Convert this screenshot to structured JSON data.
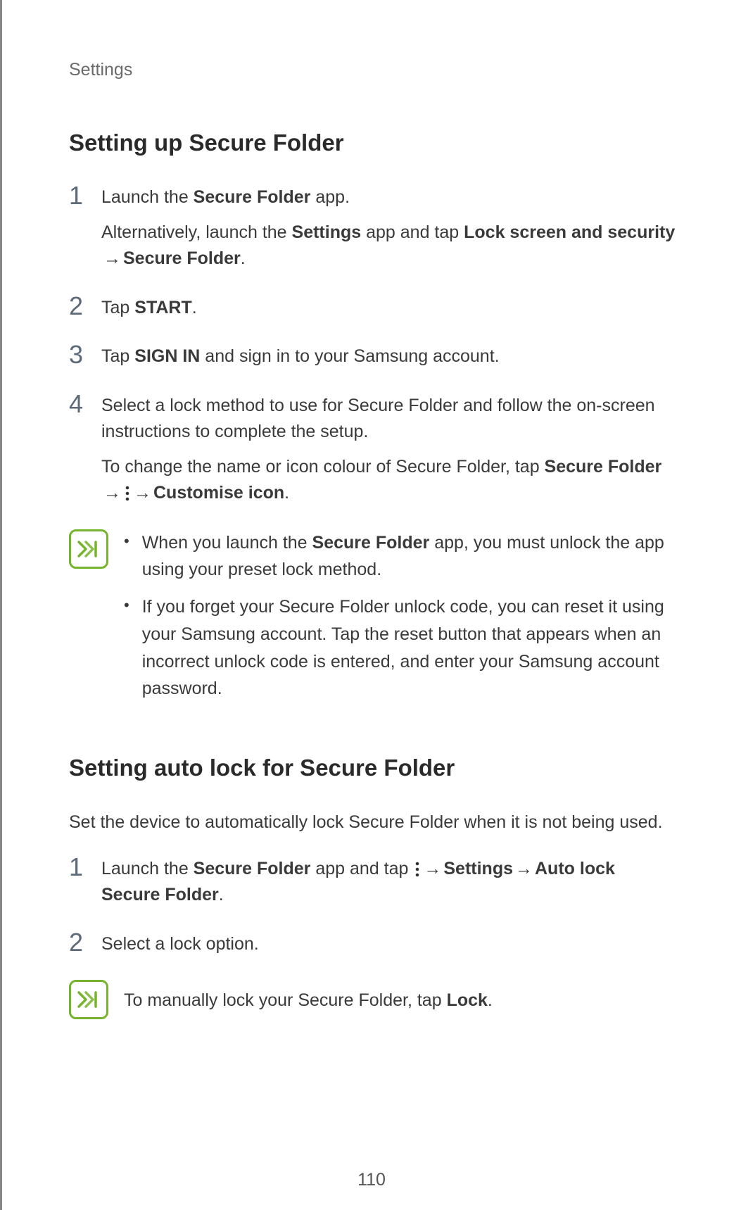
{
  "header": "Settings",
  "section1": {
    "heading": "Setting up Secure Folder",
    "steps": {
      "1": {
        "num": "1",
        "line1_a": "Launch the ",
        "line1_b": "Secure Folder",
        "line1_c": " app.",
        "line2_a": "Alternatively, launch the ",
        "line2_b": "Settings",
        "line2_c": " app and tap ",
        "line2_d": "Lock screen and security",
        "line2_e": "Secure Folder",
        "line2_f": "."
      },
      "2": {
        "num": "2",
        "line_a": "Tap ",
        "line_b": "START",
        "line_c": "."
      },
      "3": {
        "num": "3",
        "line_a": "Tap ",
        "line_b": "SIGN IN",
        "line_c": " and sign in to your Samsung account."
      },
      "4": {
        "num": "4",
        "line1": "Select a lock method to use for Secure Folder and follow the on-screen instructions to complete the setup.",
        "line2_a": "To change the name or icon colour of Secure Folder, tap ",
        "line2_b": "Secure Folder",
        "line2_c": "Customise icon",
        "line2_d": "."
      }
    },
    "note": {
      "b1_a": "When you launch the ",
      "b1_b": "Secure Folder",
      "b1_c": " app, you must unlock the app using your preset lock method.",
      "b2": "If you forget your Secure Folder unlock code, you can reset it using your Samsung account. Tap the reset button that appears when an incorrect unlock code is entered, and enter your Samsung account password."
    }
  },
  "section2": {
    "heading": "Setting auto lock for Secure Folder",
    "intro": "Set the device to automatically lock Secure Folder when it is not being used.",
    "steps": {
      "1": {
        "num": "1",
        "a": "Launch the ",
        "b": "Secure Folder",
        "c": " app and tap ",
        "d": "Settings",
        "e": "Auto lock Secure Folder",
        "f": "."
      },
      "2": {
        "num": "2",
        "a": "Select a lock option."
      }
    },
    "note": {
      "a": "To manually lock your Secure Folder, tap ",
      "b": "Lock",
      "c": "."
    }
  },
  "arrow": "→",
  "bullet": "•",
  "pagenum": "110"
}
